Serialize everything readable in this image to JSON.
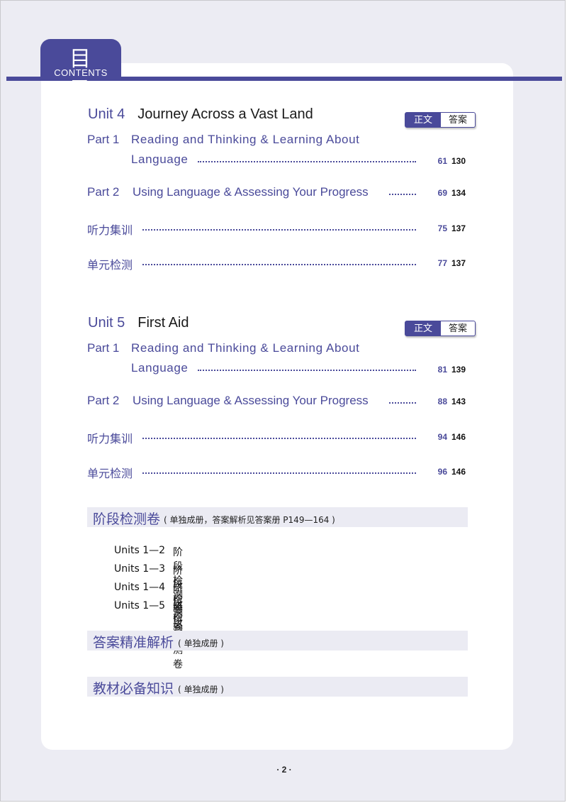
{
  "header": {
    "title_cn": "目 录",
    "title_en": "CONTENTS"
  },
  "units": [
    {
      "number": "Unit 4",
      "title": "Journey Across a Vast Land",
      "badge": {
        "main": "正文",
        "answer": "答案"
      },
      "entries": [
        {
          "label": "Part 1",
          "text_line1": "Reading and Thinking & Learning About",
          "text_line2": "Language",
          "page": "61",
          "answer_page": "130"
        },
        {
          "label": "Part 2",
          "text_line1": "Using Language & Assessing Your Progress",
          "page": "69",
          "answer_page": "134"
        },
        {
          "label": "听力集训",
          "page": "75",
          "answer_page": "137"
        },
        {
          "label": "单元检测",
          "page": "77",
          "answer_page": "137"
        }
      ]
    },
    {
      "number": "Unit 5",
      "title": "First Aid",
      "badge": {
        "main": "正文",
        "answer": "答案"
      },
      "entries": [
        {
          "label": "Part 1",
          "text_line1": "Reading and Thinking & Learning About",
          "text_line2": "Language",
          "page": "81",
          "answer_page": "139"
        },
        {
          "label": "Part 2",
          "text_line1": "Using Language & Assessing Your Progress",
          "page": "88",
          "answer_page": "143"
        },
        {
          "label": "听力集训",
          "page": "94",
          "answer_page": "146"
        },
        {
          "label": "单元检测",
          "page": "96",
          "answer_page": "146"
        }
      ]
    }
  ],
  "sections": [
    {
      "heading": "阶段检测卷",
      "note": "( 单独成册，答案解析见答案册 P149—164 )"
    },
    {
      "heading": "答案精准解析",
      "note": "( 单独成册 )"
    },
    {
      "heading": "教材必备知识",
      "note": "( 单独成册 )"
    }
  ],
  "stage_tests": [
    {
      "units": "Units 1—2",
      "name": "阶段检测卷"
    },
    {
      "units": "Units 1—3",
      "name": "阶段检测卷"
    },
    {
      "units": "Units 1—4",
      "name": "阶段检测卷"
    },
    {
      "units": "Units 1—5",
      "name": "阶段检测卷"
    }
  ],
  "footer": {
    "page_number": "· 2 ·"
  }
}
